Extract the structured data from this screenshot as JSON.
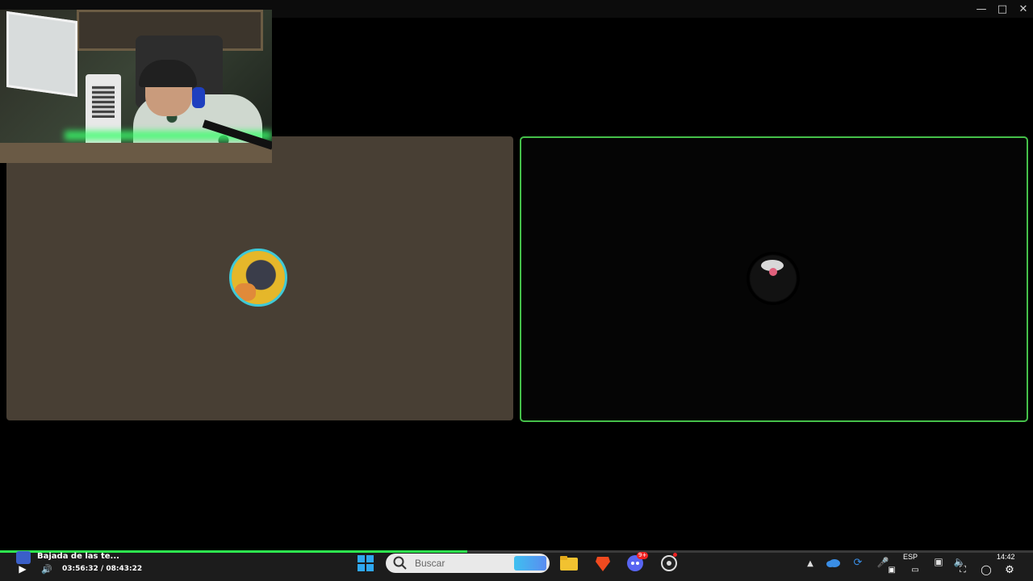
{
  "window": {
    "minimize_icon": "minimize-icon",
    "maximize_icon": "maximize-icon",
    "close_icon": "close-icon"
  },
  "player": {
    "video_title": "Bajada de las te...",
    "time_current": "03:56:32",
    "time_separator": "/",
    "time_total": "08:43:22",
    "progress_fraction": 0.452
  },
  "taskbar": {
    "search_placeholder": "Buscar",
    "discord_badge": "9+",
    "language": "ESP",
    "clock": "14:42"
  },
  "colors": {
    "progress": "#2ee84f",
    "speaking_border": "#45c04a",
    "left_panel": "#483f34"
  }
}
